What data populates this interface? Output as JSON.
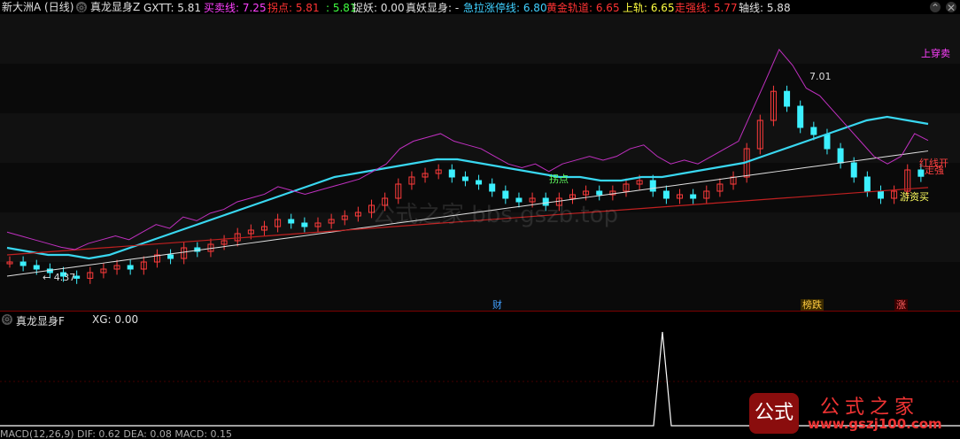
{
  "header": {
    "stock": "新大洲A (日线)",
    "indicator": "真龙显身Z",
    "items": [
      {
        "label": "GXTT: 5.81",
        "color": "#e0e0e0"
      },
      {
        "label": "买卖线: 7.25",
        "color": "#ff40ff"
      },
      {
        "label": "拐点: 5.81",
        "color": "#ff3333"
      },
      {
        "label": ": 5.81",
        "color": "#40ff40"
      },
      {
        "label": "捉妖: 0.00",
        "color": "#e0e0e0"
      },
      {
        "label": "真妖显身: -",
        "color": "#e0e0e0"
      },
      {
        "label": "急拉涨停线: 6.80",
        "color": "#40d0ff"
      },
      {
        "label": "黄金轨道: 6.65",
        "color": "#ff3333"
      },
      {
        "label": "上轨: 6.65",
        "color": "#ffff40"
      },
      {
        "label": "走强线: 5.77",
        "color": "#ff3333"
      },
      {
        "label": "轴线: 5.88",
        "color": "#e0e0e0"
      }
    ]
  },
  "chart_labels": {
    "high": "7.01",
    "low": "4.37",
    "upper_right": "上穿卖",
    "red_line": "红线开",
    "trend": "走强",
    "hot_money": "游资买",
    "pivot": "拐点"
  },
  "signal_tags": [
    {
      "text": "财",
      "color": "#40a0ff"
    },
    {
      "text": "榜跌",
      "color": "#ffcc40"
    },
    {
      "text": "涨",
      "color": "#ff6060"
    }
  ],
  "panel2": {
    "indicator": "真龙显身F",
    "xg": "XG: 0.00"
  },
  "bottom": "MACD(12,26,9) DIF: 0.62 DEA: 0.08 MACD: 0.15",
  "watermark": "公式之家 bbs.gszb.top",
  "logo": {
    "badge": "公式",
    "name": "公式之家",
    "url": "www.gszj100.com"
  },
  "chart_data": {
    "type": "line",
    "price_close": [
      4.6,
      4.55,
      4.5,
      4.45,
      4.4,
      4.37,
      4.45,
      4.5,
      4.55,
      4.5,
      4.6,
      4.7,
      4.65,
      4.8,
      4.75,
      4.85,
      4.9,
      5.0,
      5.05,
      5.1,
      5.2,
      5.15,
      5.1,
      5.15,
      5.2,
      5.25,
      5.3,
      5.4,
      5.5,
      5.7,
      5.8,
      5.85,
      5.9,
      5.8,
      5.75,
      5.7,
      5.6,
      5.5,
      5.45,
      5.5,
      5.4,
      5.5,
      5.55,
      5.6,
      5.55,
      5.6,
      5.7,
      5.75,
      5.6,
      5.5,
      5.55,
      5.5,
      5.6,
      5.7,
      5.8,
      6.2,
      6.6,
      7.01,
      6.8,
      6.5,
      6.4,
      6.2,
      6.0,
      5.8,
      5.6,
      5.5,
      5.6,
      5.9,
      5.81
    ],
    "fast_line": [
      4.8,
      4.75,
      4.7,
      4.7,
      4.65,
      4.7,
      4.8,
      4.9,
      5.0,
      5.1,
      5.2,
      5.3,
      5.4,
      5.5,
      5.6,
      5.7,
      5.8,
      5.85,
      5.9,
      5.95,
      6.0,
      6.05,
      6.05,
      6.0,
      5.95,
      5.9,
      5.85,
      5.8,
      5.8,
      5.75,
      5.75,
      5.8,
      5.8,
      5.85,
      5.9,
      5.95,
      6.0,
      6.1,
      6.2,
      6.3,
      6.4,
      6.5,
      6.6,
      6.65,
      6.6,
      6.55
    ],
    "series_names": []
  }
}
